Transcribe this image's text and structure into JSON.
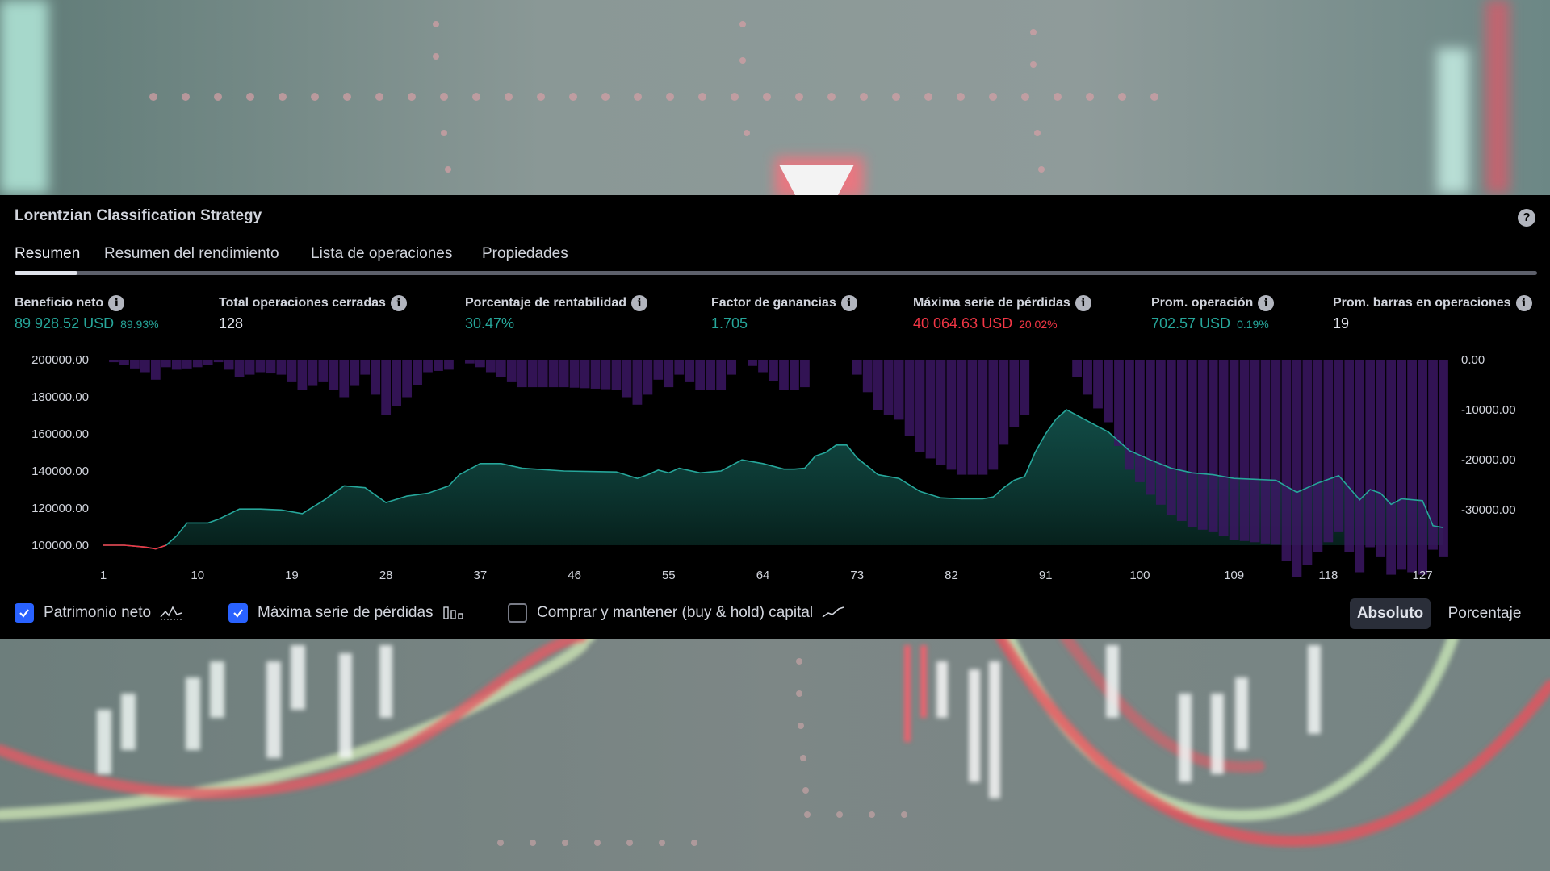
{
  "strategy_title": "Lorentzian Classification Strategy",
  "help_icon_glyph": "?",
  "tabs": [
    {
      "label": "Resumen",
      "active": true
    },
    {
      "label": "Resumen del rendimiento",
      "active": false
    },
    {
      "label": "Lista de operaciones",
      "active": false
    },
    {
      "label": "Propiedades",
      "active": false
    }
  ],
  "metrics": [
    {
      "label": "Beneficio neto",
      "value": "89 928.52 USD",
      "sub": "89.93%",
      "color": "green"
    },
    {
      "label": "Total operaciones cerradas",
      "value": "128",
      "sub": "",
      "color": "white"
    },
    {
      "label": "Porcentaje de rentabilidad",
      "value": "30.47%",
      "sub": "",
      "color": "green"
    },
    {
      "label": "Factor de ganancias",
      "value": "1.705",
      "sub": "",
      "color": "green"
    },
    {
      "label": "Máxima serie de pérdidas",
      "value": "40 064.63 USD",
      "sub": "20.02%",
      "color": "red"
    },
    {
      "label": "Prom. operación",
      "value": "702.57 USD",
      "sub": "0.19%",
      "color": "green"
    },
    {
      "label": "Prom. barras en operaciones",
      "value": "19",
      "sub": "",
      "color": "white"
    }
  ],
  "info_glyph": "i",
  "legend": [
    {
      "label": "Patrimonio neto",
      "checked": true,
      "icon": "equity-line-icon"
    },
    {
      "label": "Máxima serie de pérdidas",
      "checked": true,
      "icon": "bar-chart-icon"
    },
    {
      "label": "Comprar y mantener (buy & hold) capital",
      "checked": false,
      "icon": "trend-line-icon"
    }
  ],
  "mode_buttons": [
    {
      "label": "Absoluto",
      "active": true
    },
    {
      "label": "Porcentaje",
      "active": false
    }
  ],
  "colors": {
    "equity_line": "#26a69a",
    "equity_fill": "#0c3b33",
    "drawdown_bar": "#3b1663",
    "negative": "#f23645",
    "accent_blue": "#2962ff"
  },
  "chart_data": {
    "type": "area",
    "x_tick_labels": [
      "1",
      "10",
      "19",
      "28",
      "37",
      "46",
      "55",
      "64",
      "73",
      "82",
      "91",
      "100",
      "109",
      "118",
      "127"
    ],
    "x_range": [
      1,
      129
    ],
    "left_axis": {
      "ticks": [
        "200000.00",
        "180000.00",
        "160000.00",
        "140000.00",
        "120000.00",
        "100000.00"
      ],
      "range": [
        100000,
        200000
      ]
    },
    "right_axis": {
      "ticks": [
        "0.00",
        "-10000.00",
        "-20000.00",
        "-30000.00"
      ],
      "range": [
        -37000,
        0
      ]
    },
    "series": [
      {
        "name": "Patrimonio neto",
        "kind": "equity",
        "x": [
          1,
          3,
          5,
          6,
          7,
          8,
          9,
          10,
          11,
          12,
          14,
          16,
          18,
          20,
          22,
          24,
          26,
          28,
          30,
          32,
          34,
          35,
          37,
          39,
          41,
          45,
          50,
          52,
          53,
          54,
          55,
          56,
          58,
          60,
          62,
          64,
          66,
          67,
          68,
          69,
          70,
          71,
          72,
          73,
          75,
          77,
          79,
          81,
          83,
          85,
          86,
          87,
          88,
          89,
          90,
          91,
          92,
          93,
          95,
          97,
          99,
          101,
          103,
          105,
          107,
          109,
          111,
          113,
          115,
          117,
          119,
          121,
          122,
          123,
          124,
          125,
          127,
          128,
          129
        ],
        "y": [
          100000,
          100000,
          99000,
          98000,
          100000,
          105000,
          112000,
          112000,
          112000,
          114000,
          119500,
          119500,
          119000,
          117000,
          124000,
          132000,
          131000,
          123000,
          126500,
          128000,
          132000,
          138000,
          144000,
          144000,
          141500,
          140000,
          139500,
          136000,
          138000,
          140500,
          139000,
          141500,
          139000,
          140000,
          146000,
          144000,
          141000,
          141000,
          141500,
          148000,
          150000,
          154000,
          154000,
          147000,
          138000,
          136000,
          129000,
          125500,
          125000,
          125000,
          126000,
          131000,
          135000,
          137000,
          150000,
          160000,
          168000,
          173000,
          167000,
          161000,
          151000,
          146000,
          141500,
          139000,
          138000,
          136000,
          135500,
          135000,
          128500,
          133500,
          137500,
          124500,
          130000,
          128000,
          122000,
          125000,
          124000,
          110500,
          109500
        ]
      },
      {
        "name": "Máxima serie de pérdidas",
        "kind": "drawdown",
        "x": [
          1,
          3,
          5,
          6,
          7,
          8,
          10,
          12,
          14,
          16,
          18,
          20,
          22,
          24,
          26,
          28,
          30,
          32,
          34,
          35,
          37,
          39,
          41,
          45,
          50,
          52,
          53,
          54,
          55,
          56,
          58,
          60,
          62,
          64,
          66,
          67,
          68,
          69,
          70,
          71,
          72,
          73,
          75,
          77,
          79,
          81,
          83,
          85,
          86,
          87,
          88,
          89,
          90,
          91,
          92,
          93,
          95,
          97,
          99,
          101,
          103,
          105,
          107,
          109,
          111,
          113,
          115,
          117,
          119,
          121,
          122,
          123,
          124,
          125,
          127,
          128,
          129
        ],
        "y": [
          0,
          -1000,
          -2500,
          -4000,
          -1500,
          -2000,
          -1500,
          -500,
          -3500,
          -2500,
          -3000,
          -6000,
          -4500,
          -7500,
          -3000,
          -11000,
          -7500,
          -2500,
          -2000,
          0,
          -1500,
          -3500,
          -5500,
          -5500,
          -6000,
          -9000,
          -7000,
          -4000,
          -5500,
          -3000,
          -6000,
          -6000,
          0,
          -2500,
          -6000,
          -6000,
          -5500,
          0,
          0,
          0,
          0,
          -3000,
          -10000,
          -12000,
          -18500,
          -21000,
          -23000,
          -23000,
          -22000,
          -17000,
          -13500,
          -11000,
          0,
          0,
          0,
          0,
          -7000,
          -12500,
          -22000,
          -27000,
          -31000,
          -33500,
          -34500,
          -36000,
          -36500,
          -37000,
          -43500,
          -38500,
          -34500,
          -42500,
          -37500,
          -39500,
          -43000,
          -42000,
          -43000,
          -38000,
          -39500
        ]
      }
    ],
    "tick_note_left": "",
    "grid": false
  }
}
